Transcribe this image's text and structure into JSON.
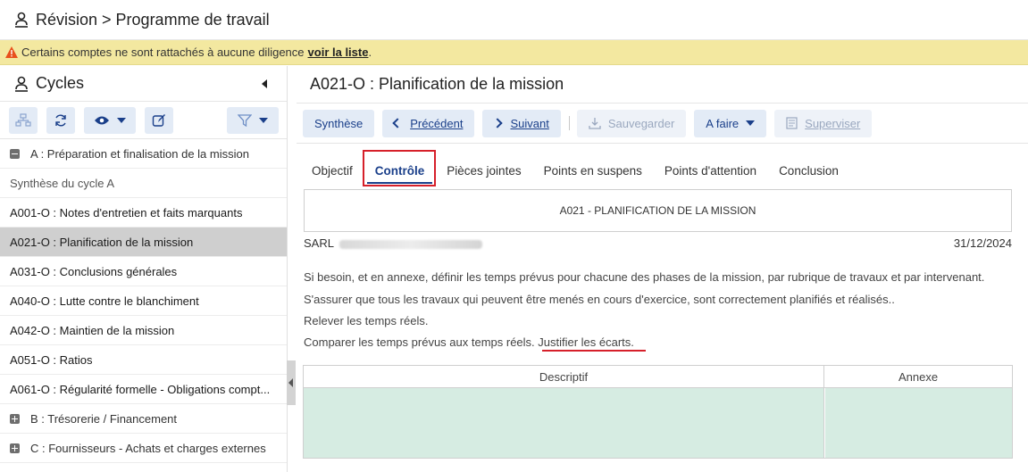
{
  "header": {
    "title": "Révision > Programme de travail"
  },
  "warning": {
    "text": "Certains comptes ne sont rattachés à aucune diligence",
    "link": "voir la liste",
    "suffix": "."
  },
  "sidebar": {
    "title": "Cycles",
    "items": [
      {
        "label": "A : Préparation et finalisation de la mission"
      },
      {
        "label": "Synthèse du cycle A"
      },
      {
        "label": "A001-O : Notes d'entretien et faits marquants"
      },
      {
        "label": "A021-O : Planification de la mission"
      },
      {
        "label": "A031-O : Conclusions générales"
      },
      {
        "label": "A040-O : Lutte contre le blanchiment"
      },
      {
        "label": "A042-O : Maintien de la mission"
      },
      {
        "label": "A051-O : Ratios"
      },
      {
        "label": "A061-O : Régularité formelle - Obligations compt..."
      },
      {
        "label": "B : Trésorerie / Financement"
      },
      {
        "label": "C : Fournisseurs - Achats et charges externes"
      }
    ]
  },
  "main": {
    "title": "A021-O : Planification de la mission",
    "actions": {
      "synthese": "Synthèse",
      "precedent": "Précédent",
      "suivant": "Suivant",
      "sauvegarder": "Sauvegarder",
      "status": "A faire",
      "superviser": "Superviser"
    },
    "tabs": [
      "Objectif",
      "Contrôle",
      "Pièces jointes",
      "Points en suspens",
      "Points d'attention",
      "Conclusion"
    ],
    "doc_title": "A021 - PLANIFICATION DE LA MISSION",
    "company": "SARL",
    "date": "31/12/2024",
    "paragraphs": [
      "Si besoin, et en annexe, définir les temps prévus pour chacune des phases de la mission, par rubrique de travaux et par intervenant.",
      "S'assurer que tous les travaux qui peuvent être menés en cours d'exercice, sont correctement planifiés et réalisés..",
      "Relever les temps réels.",
      "Comparer les temps prévus aux temps réels. Justifier les écarts."
    ],
    "table": {
      "col1": "Descriptif",
      "col2": "Annexe"
    }
  }
}
